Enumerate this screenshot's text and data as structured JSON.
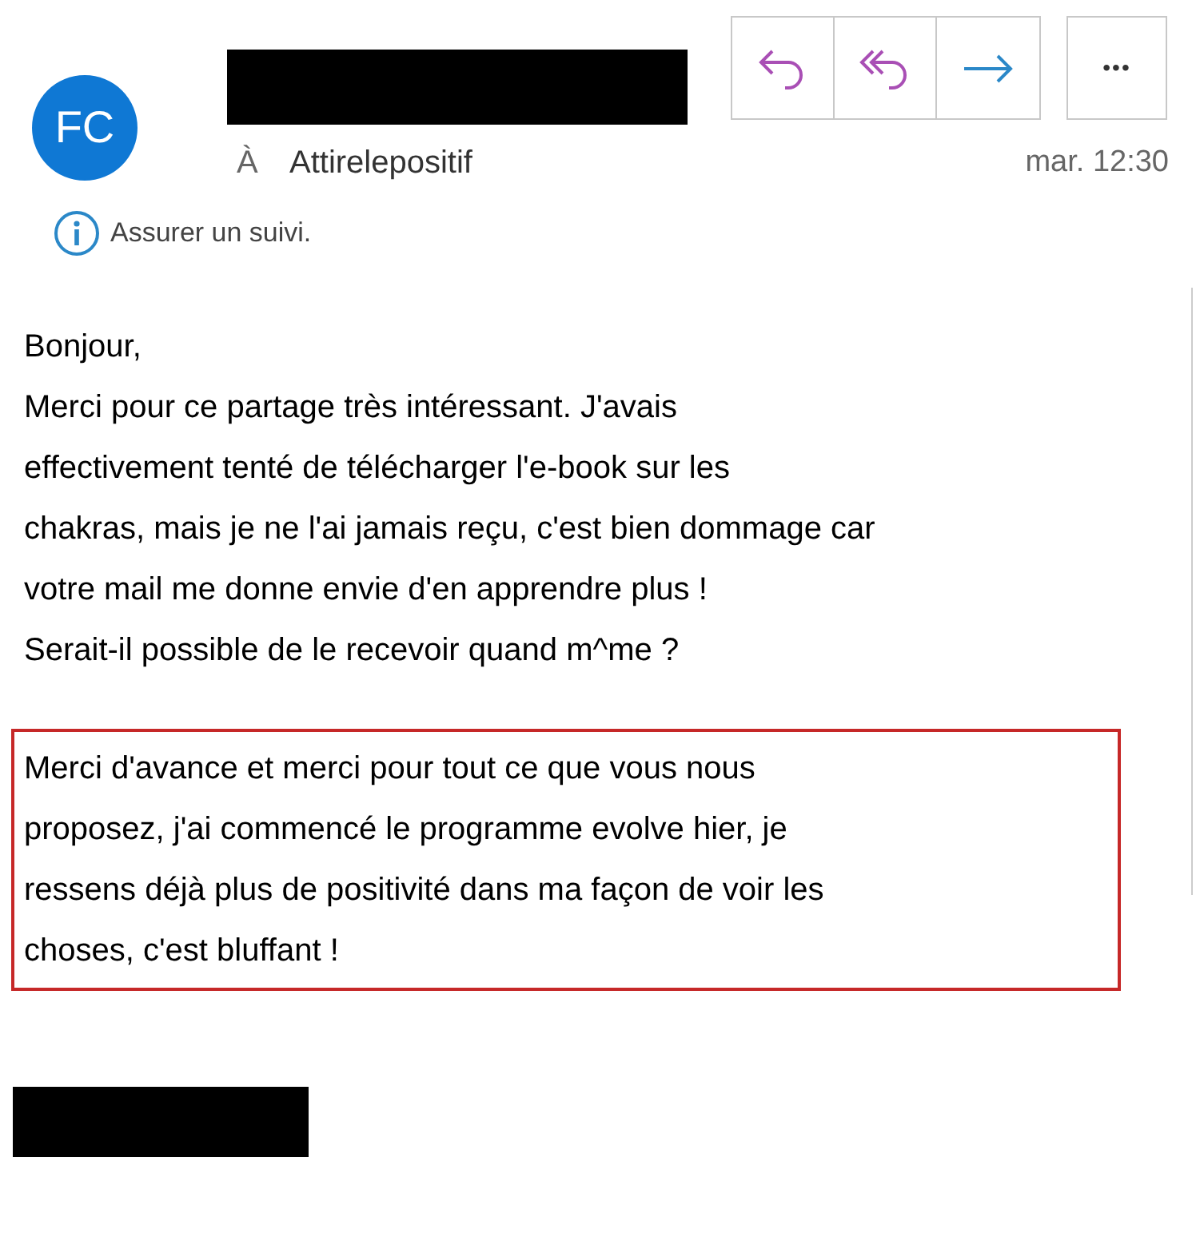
{
  "sender": {
    "initials": "FC",
    "to_label": "À",
    "to": "Attirelepositif",
    "time": "mar. 12:30"
  },
  "toolbar": {
    "more": "•••"
  },
  "notice": "Assurer un suivi.",
  "body": {
    "paragraphs": [
      {
        "highlighted": false,
        "lines": [
          "Bonjour,",
          "Merci pour ce partage très intéressant. J'avais",
          "effectivement tenté de télécharger l'e-book sur les",
          "chakras, mais je ne l'ai jamais reçu, c'est bien dommage car",
          "votre mail me donne envie d'en apprendre plus !",
          "Serait-il possible de le recevoir quand m^me ?"
        ]
      },
      {
        "highlighted": true,
        "lines": [
          "Merci d'avance et merci pour tout ce que vous nous",
          "proposez, j'ai commencé le programme evolve hier, je",
          "ressens déjà plus de positivité dans ma façon de voir les",
          "choses, c'est bluffant !"
        ]
      }
    ]
  }
}
